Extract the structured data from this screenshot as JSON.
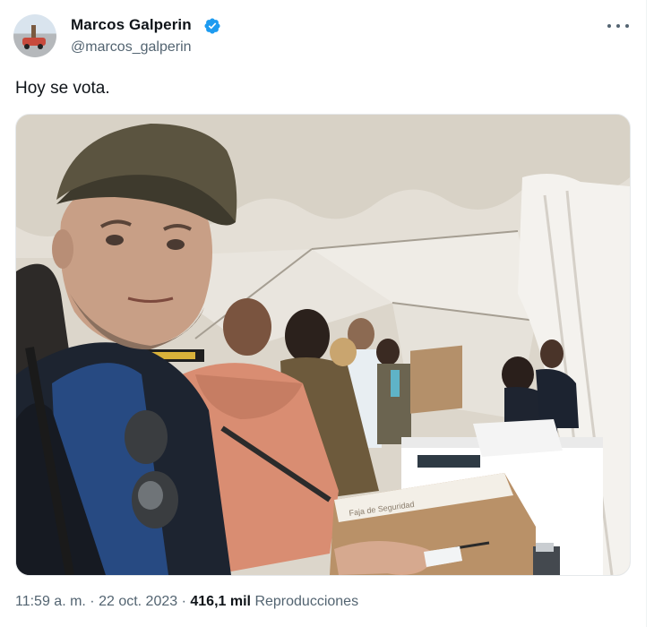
{
  "author": {
    "name": "Marcos Galperin",
    "handle": "@marcos_galperin",
    "verified": true
  },
  "tweet": {
    "text": "Hoy se vota.",
    "time": "11:59 a. m.",
    "separator": " · ",
    "date": "22 oct. 2023",
    "views_count": "416,1 mil",
    "views_label": "Reproducciones"
  },
  "media": {
    "box_label": "Faja de Seguridad"
  },
  "colors": {
    "accent": "#1d9bf0",
    "secondary_text": "#536471",
    "primary_text": "#0f1419"
  },
  "icons": [
    "verified-badge-icon",
    "more-options-icon"
  ]
}
